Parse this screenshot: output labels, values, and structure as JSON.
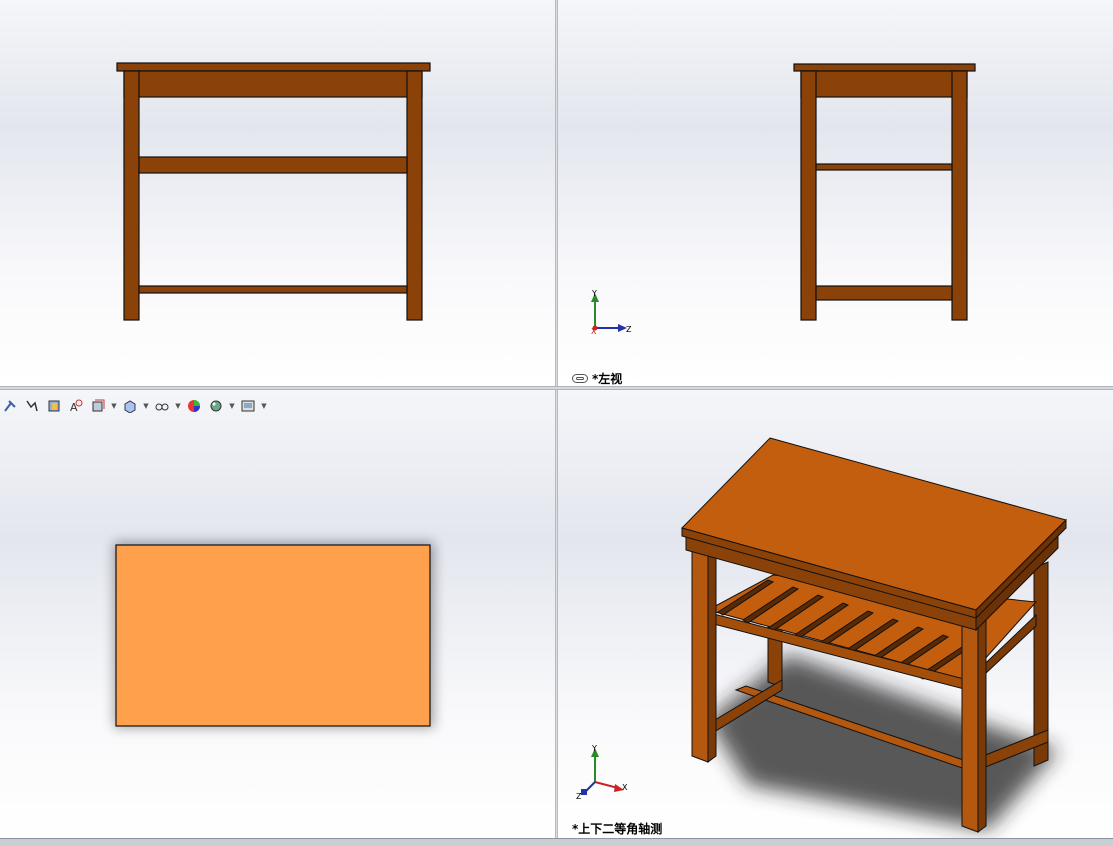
{
  "viewports": {
    "front": {
      "label": ""
    },
    "left": {
      "label": "*左视"
    },
    "top": {
      "label": ""
    },
    "iso": {
      "label": "*上下二等角轴测"
    }
  },
  "triad": {
    "x": "X",
    "y": "Y",
    "z": "Z"
  },
  "toolbar": {
    "items": [
      "hide-show-icon",
      "edit-appearance-icon",
      "section-view-icon",
      "view-orientation-icon",
      "display-style-icon",
      "hide-show-items-icon",
      "appearance-icon",
      "scene-icon",
      "view-settings-icon"
    ]
  },
  "colors": {
    "wood_dark": "#7a3a08",
    "wood_mid": "#a34f0b",
    "wood_light": "#c25e0e",
    "top_face": "#ffa04c",
    "outline": "#111111"
  }
}
